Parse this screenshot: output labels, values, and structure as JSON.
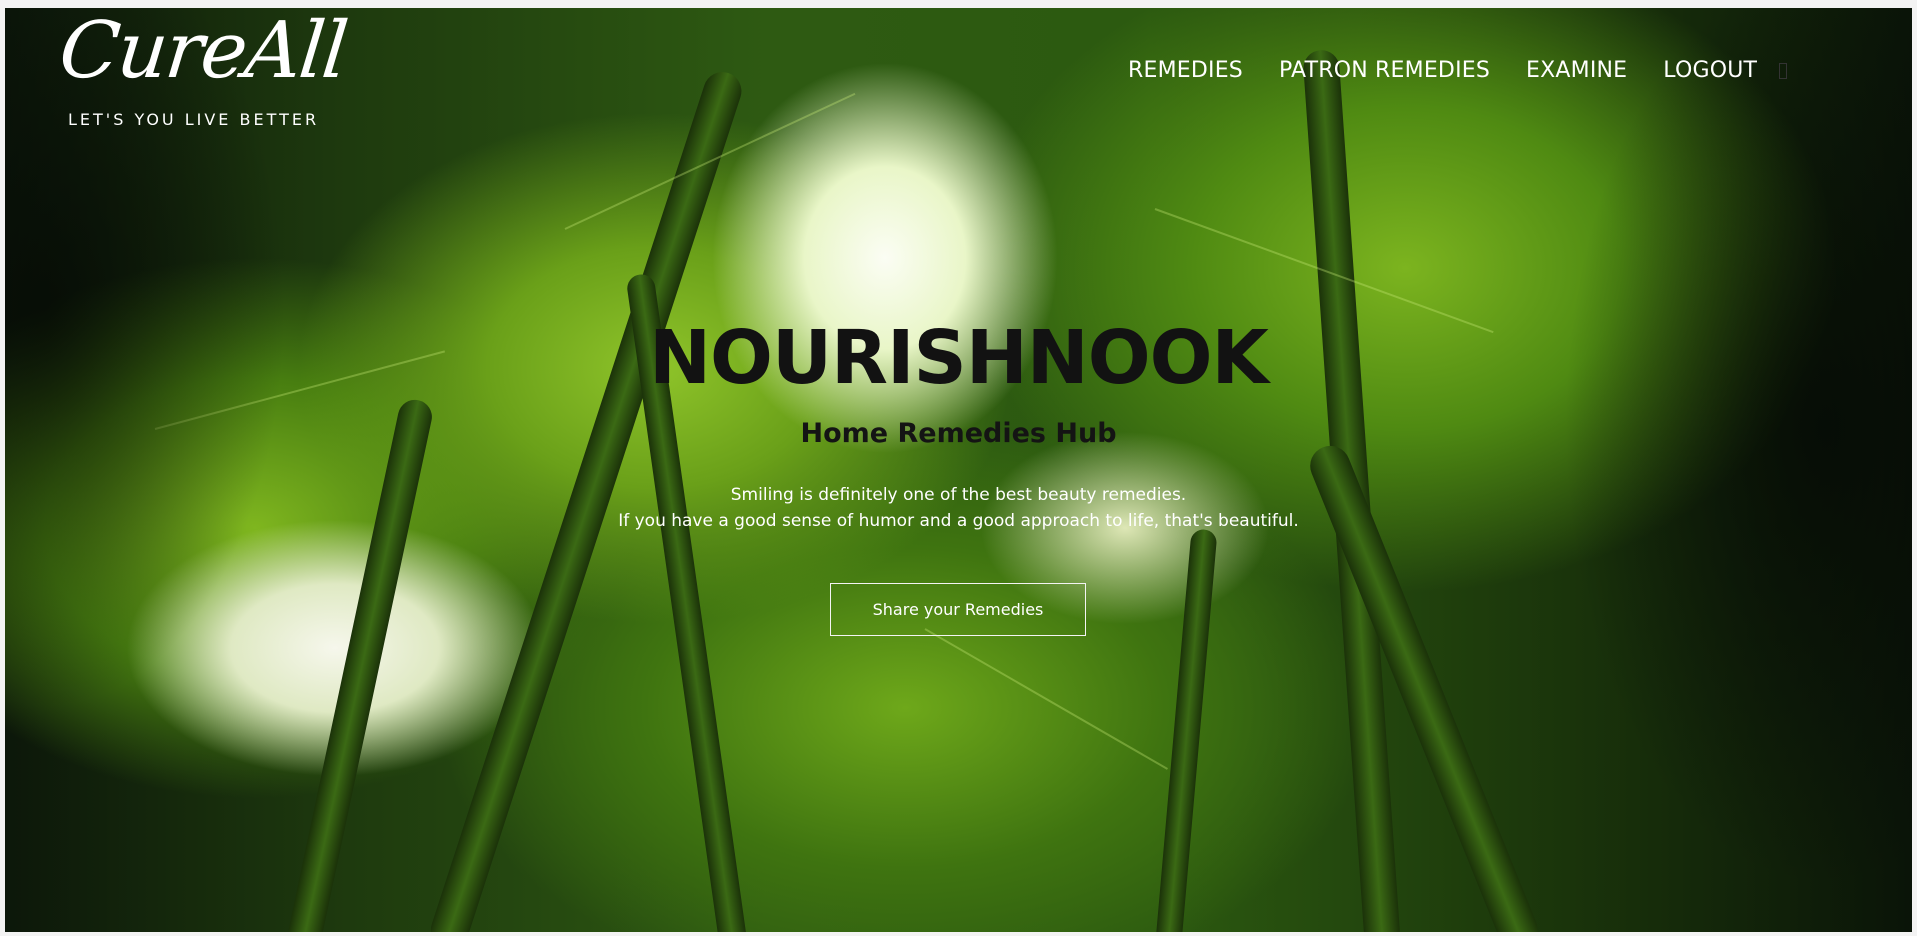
{
  "brand": {
    "logo_text": "CureAll",
    "tagline": "LET'S YOU LIVE BETTER"
  },
  "nav": {
    "items": [
      {
        "label": "REMEDIES"
      },
      {
        "label": "PATRON REMEDIES"
      },
      {
        "label": "EXAMINE"
      },
      {
        "label": "LOGOUT"
      }
    ]
  },
  "hero": {
    "title": "NOURISHNOOK",
    "subtitle": "Home Remedies Hub",
    "quote_line1": "Smiling is definitely one of the best beauty remedies.",
    "quote_line2": "If you have a good sense of humor and a good approach to life, that's beautiful.",
    "cta_label": "Share your Remedies"
  },
  "colors": {
    "foliage": "#3f7410",
    "text_dark": "#121212",
    "text_light": "#ffffff"
  }
}
